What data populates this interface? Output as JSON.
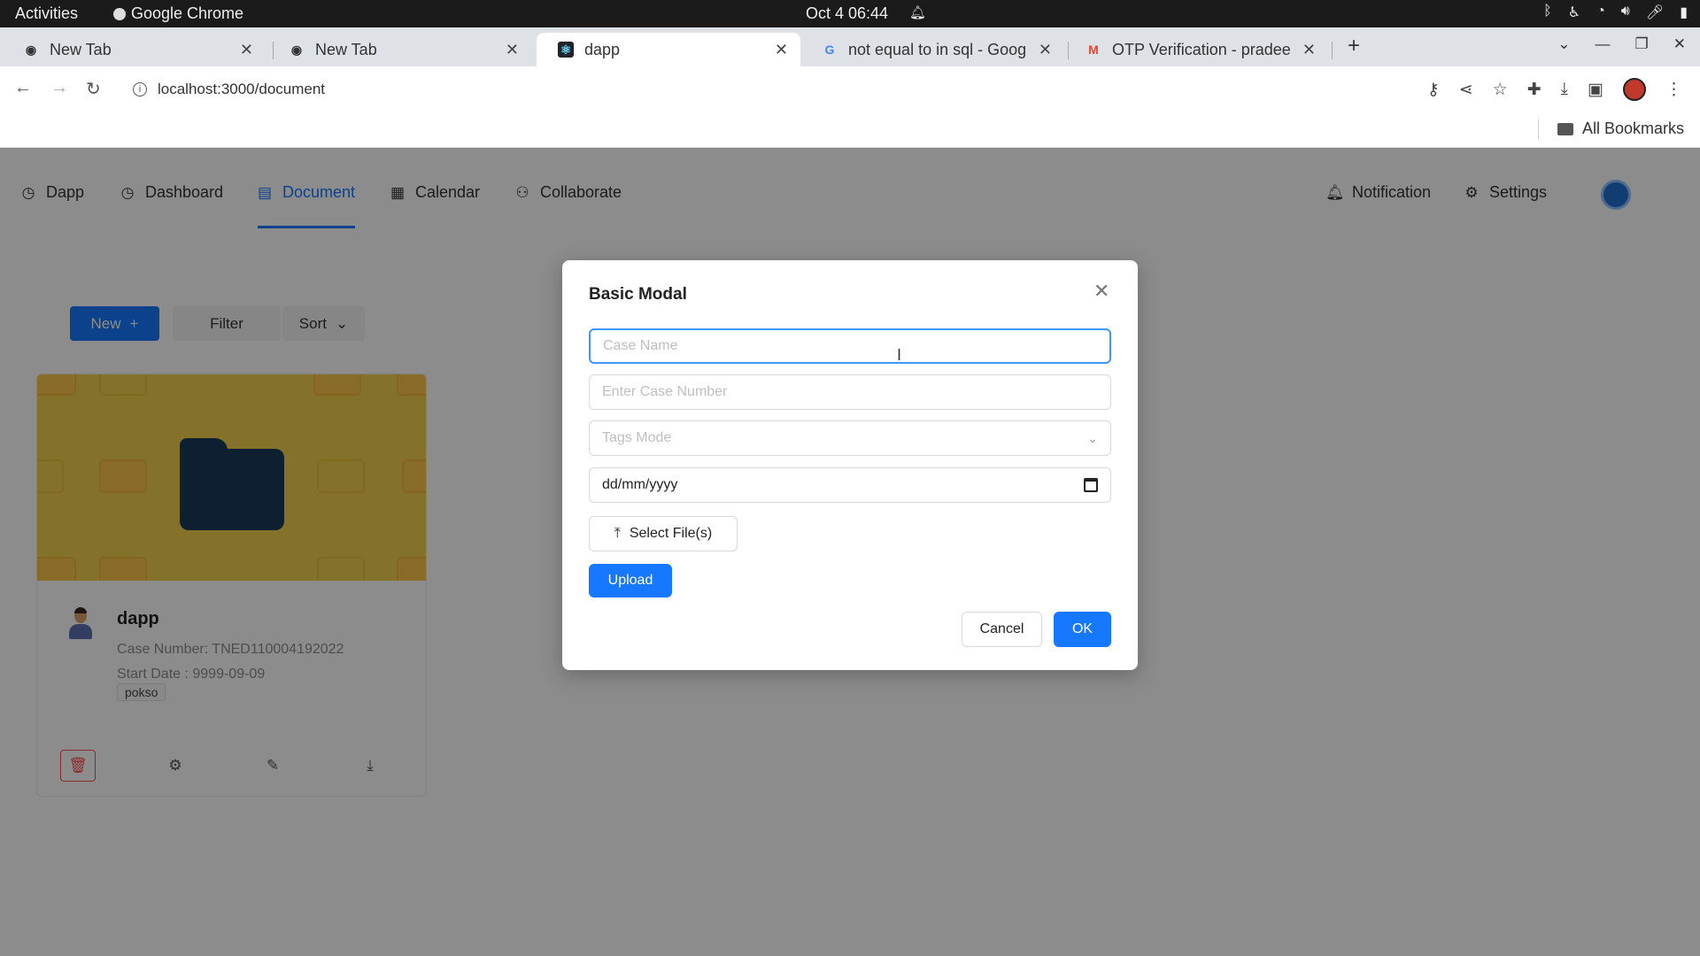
{
  "system_bar": {
    "activities": "Activities",
    "app_name": "Google Chrome",
    "clock": "Oct 4  06:44"
  },
  "browser": {
    "tabs": [
      {
        "title": "New Tab",
        "icon": "chrome-icon"
      },
      {
        "title": "New Tab",
        "icon": "chrome-icon"
      },
      {
        "title": "dapp",
        "icon": "react-icon",
        "active": true
      },
      {
        "title": "not equal to in sql - Goog",
        "icon": "google-icon"
      },
      {
        "title": "OTP Verification - pradee",
        "icon": "gmail-icon"
      }
    ],
    "url": "localhost:3000/document",
    "bookmarks_label": "All Bookmarks"
  },
  "app_nav": {
    "brand": "Dapp",
    "items": [
      "Dashboard",
      "Document",
      "Calendar",
      "Collaborate"
    ],
    "active_item": "Document",
    "right_items": [
      "Notification",
      "Settings"
    ]
  },
  "toolbar": {
    "new_label": "New",
    "filter_label": "Filter",
    "sort_label": "Sort"
  },
  "case_card": {
    "title": "dapp",
    "case_number": "Case Number: TNED110004192022",
    "start_date": "Start Date : 9999-09-09",
    "tag": "pokso"
  },
  "modal": {
    "title": "Basic Modal",
    "case_name_placeholder": "Case Name",
    "case_number_placeholder": "Enter Case Number",
    "tags_placeholder": "Tags Mode",
    "date_value": "dd/mm/yyyy",
    "select_files_label": "Select File(s)",
    "upload_label": "Upload",
    "cancel_label": "Cancel",
    "ok_label": "OK"
  },
  "colors": {
    "primary": "#1677ff",
    "danger": "#ff4d4f",
    "card_cover": "#f2d04d",
    "folder": "#1d3a5c"
  }
}
